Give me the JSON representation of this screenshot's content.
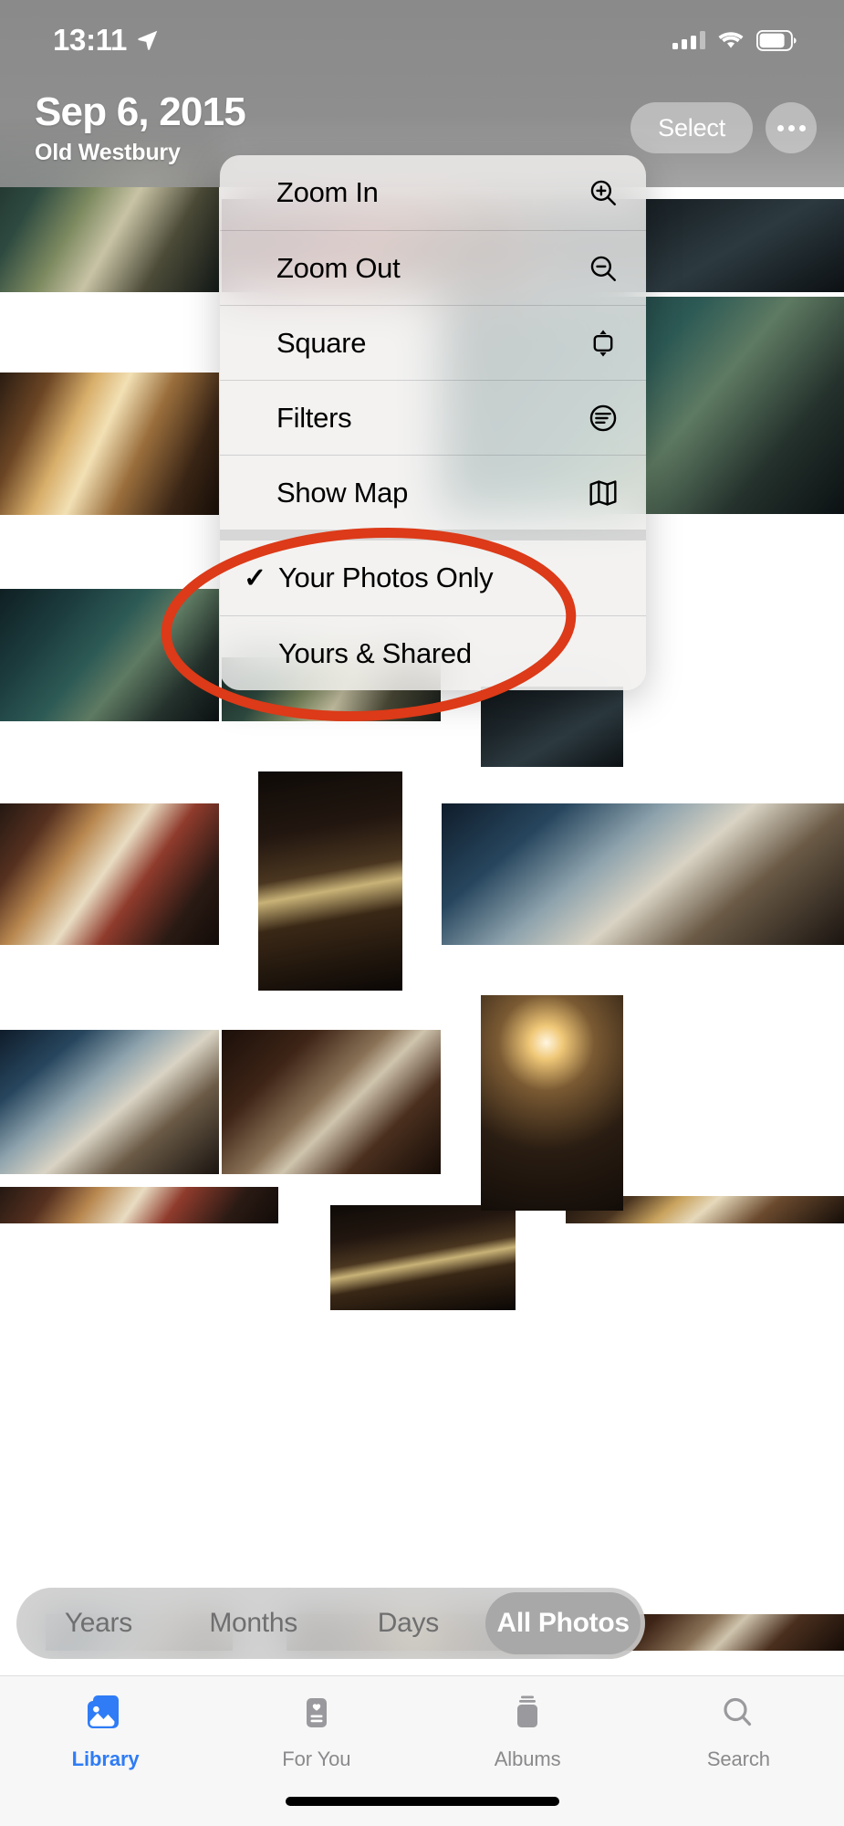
{
  "status_bar": {
    "time": "13:11",
    "location_icon": "location-arrow-icon",
    "cellular_icon": "cellular-bars-icon",
    "wifi_icon": "wifi-icon",
    "battery_icon": "battery-icon"
  },
  "header": {
    "title": "Sep 6, 2015",
    "subtitle": "Old Westbury",
    "select_label": "Select",
    "more_icon": "ellipsis-icon"
  },
  "context_menu": {
    "groups": [
      {
        "items": [
          {
            "label": "Zoom In",
            "icon": "zoom-in-icon",
            "checked": false
          },
          {
            "label": "Zoom Out",
            "icon": "zoom-out-icon",
            "checked": false
          },
          {
            "label": "Square",
            "icon": "aspect-square-icon",
            "checked": false
          },
          {
            "label": "Filters",
            "icon": "filters-icon",
            "checked": false
          },
          {
            "label": "Show Map",
            "icon": "map-icon",
            "checked": false
          }
        ]
      },
      {
        "items": [
          {
            "label": "Your Photos Only",
            "icon": "",
            "checked": true
          },
          {
            "label": "Yours & Shared",
            "icon": "",
            "checked": false
          }
        ]
      }
    ]
  },
  "annotation": {
    "shape": "ellipse",
    "color": "#DC3A18",
    "stroke_width": 11,
    "encircles": [
      "Your Photos Only",
      "Yours & Shared"
    ]
  },
  "segmented_control": {
    "options": [
      "Years",
      "Months",
      "Days",
      "All Photos"
    ],
    "selected": "All Photos"
  },
  "tab_bar": {
    "tabs": [
      {
        "label": "Library",
        "icon": "photo-stack-icon",
        "active": true
      },
      {
        "label": "For You",
        "icon": "for-you-card-icon",
        "active": false
      },
      {
        "label": "Albums",
        "icon": "albums-stack-icon",
        "active": false
      },
      {
        "label": "Search",
        "icon": "search-icon",
        "active": false
      }
    ],
    "accent_color": "#2F7CF6",
    "inactive_color": "#8A8A8D"
  },
  "photo_grid": {
    "note": "Photo library thumbnails of a historic mansion interior",
    "count": 24
  }
}
